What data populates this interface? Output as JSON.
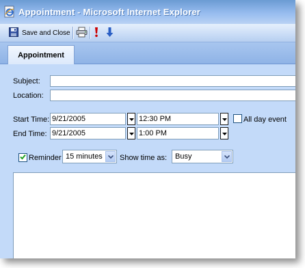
{
  "window": {
    "title": "Appointment - Microsoft Internet Explorer"
  },
  "toolbar": {
    "save_close_label": "Save and Close"
  },
  "tabs": [
    {
      "label": "Appointment"
    }
  ],
  "form": {
    "subject_label": "Subject:",
    "subject_value": "",
    "location_label": "Location:",
    "location_value": "",
    "start_time_label": "Start Time:",
    "start_date": "9/21/2005",
    "start_time": "12:30 PM",
    "all_day_label": "All day event",
    "all_day_checked": false,
    "end_time_label": "End Time:",
    "end_date": "9/21/2005",
    "end_time": "1:00 PM",
    "reminder_label": "Reminder",
    "reminder_checked": true,
    "reminder_value": "15 minutes",
    "show_time_label": "Show time as:",
    "show_time_value": "Busy",
    "notes_value": ""
  },
  "colors": {
    "window_bg": "#c3daf9",
    "title_text": "#ffffff",
    "importance_high": "#cc0000",
    "importance_low": "#2a5fc4"
  },
  "icons": [
    "ie-app-icon",
    "save-disk-icon",
    "print-icon",
    "high-importance-icon",
    "low-importance-icon",
    "chevron-down-icon",
    "checkmark-icon"
  ]
}
